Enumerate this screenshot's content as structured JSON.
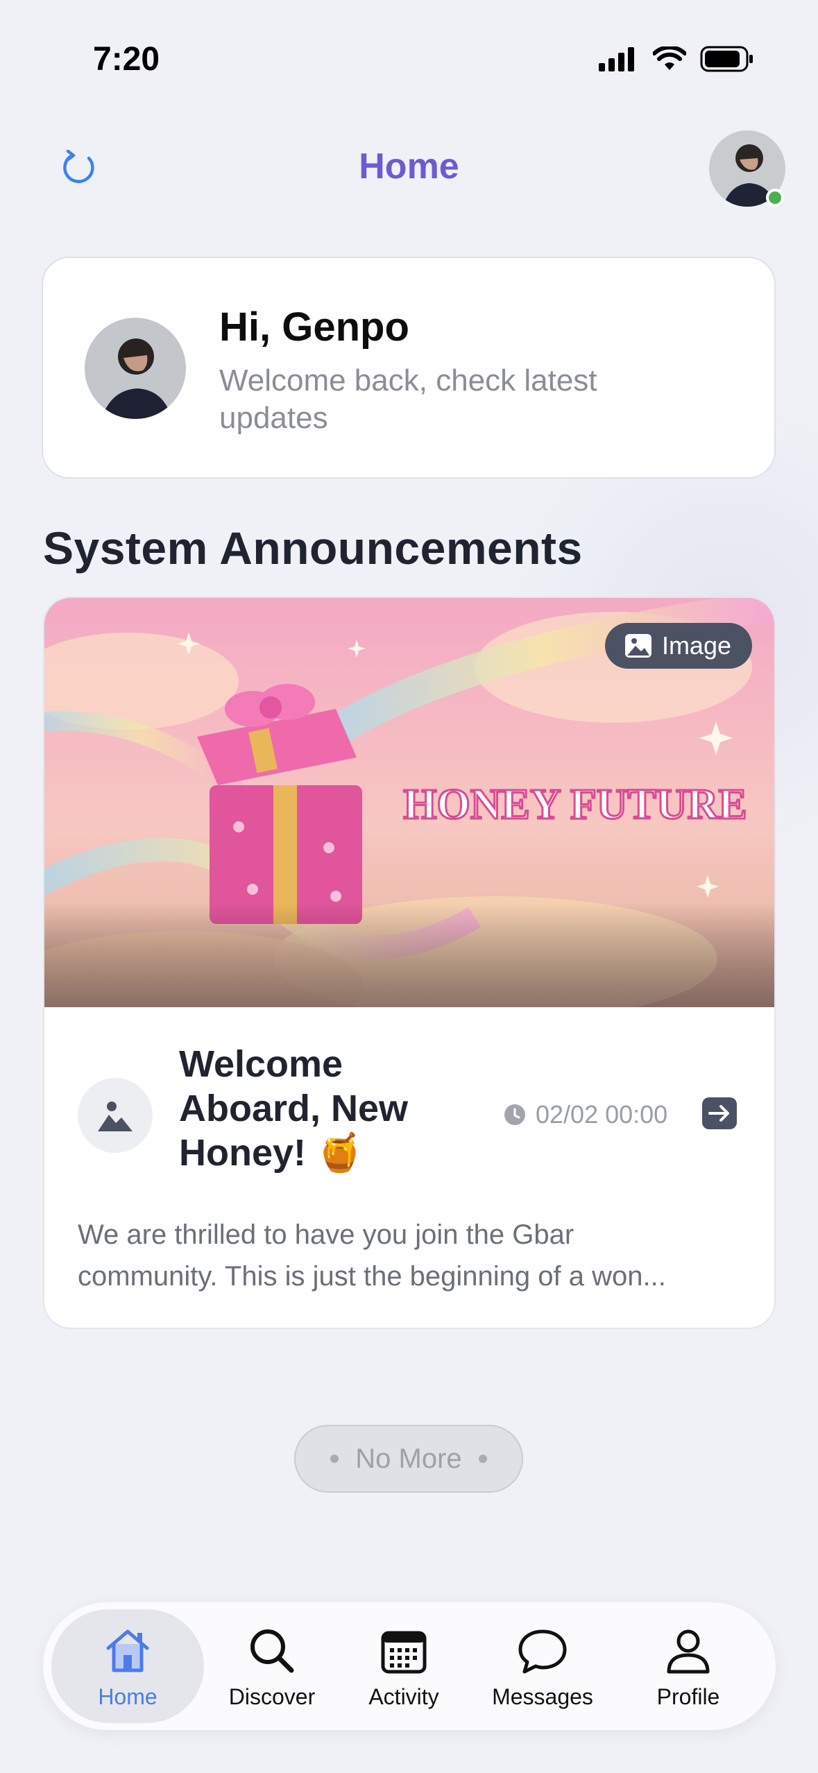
{
  "status_bar": {
    "time": "7:20"
  },
  "header": {
    "title": "Home"
  },
  "welcome": {
    "greeting": "Hi, Genpo",
    "subtitle": "Welcome back, check latest updates"
  },
  "section": {
    "title": "System Announcements"
  },
  "announcement": {
    "badge_label": "Image",
    "banner_text": "HONEY FUTURE",
    "title": "Welcome Aboard, New Honey! 🍯",
    "timestamp": "02/02 00:00",
    "body_line1": "We are thrilled to have you join the Gbar",
    "body_line2": "community. This is just the beginning of a won..."
  },
  "list_end": {
    "label": "No More"
  },
  "tabs": [
    {
      "label": "Home",
      "icon": "home-icon",
      "active": true
    },
    {
      "label": "Discover",
      "icon": "search-icon"
    },
    {
      "label": "Activity",
      "icon": "calendar-icon"
    },
    {
      "label": "Messages",
      "icon": "chat-bubble-icon"
    },
    {
      "label": "Profile",
      "icon": "person-icon"
    }
  ],
  "colors": {
    "accent_title": "#6d5bd0",
    "tab_active": "#4e7be8",
    "refresh_icon": "#3b82f6",
    "online": "#4caf50"
  }
}
